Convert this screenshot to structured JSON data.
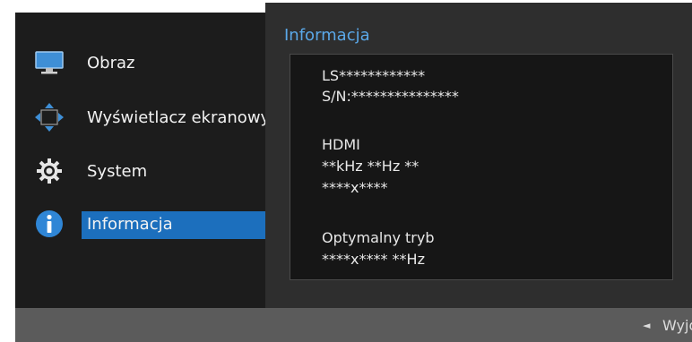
{
  "menu": {
    "items": [
      {
        "label": "Obraz",
        "icon": "monitor-icon"
      },
      {
        "label": "Wyświetlacz ekranowy",
        "icon": "move-arrows-icon"
      },
      {
        "label": "System",
        "icon": "gear-icon"
      },
      {
        "label": "Informacja",
        "icon": "info-icon"
      }
    ],
    "selected_index": 3
  },
  "submenu": {
    "title": "Informacja",
    "lines": {
      "model": "LS************",
      "serial": "S/N:***************",
      "source": "HDMI",
      "frequency": "**kHz **Hz **",
      "resolution": "****x****",
      "optimal_label": "Optymalny tryb",
      "optimal_value": "****x**** **Hz"
    }
  },
  "footer": {
    "arrow": "◄",
    "exit_label": "Wyjdź"
  },
  "colors": {
    "accent": "#1c6fbd",
    "title": "#5aa8e8",
    "menu_bg": "#1c1c1c",
    "sub_bg": "#2e2e2e",
    "footer_bg": "#5b5b5b"
  }
}
